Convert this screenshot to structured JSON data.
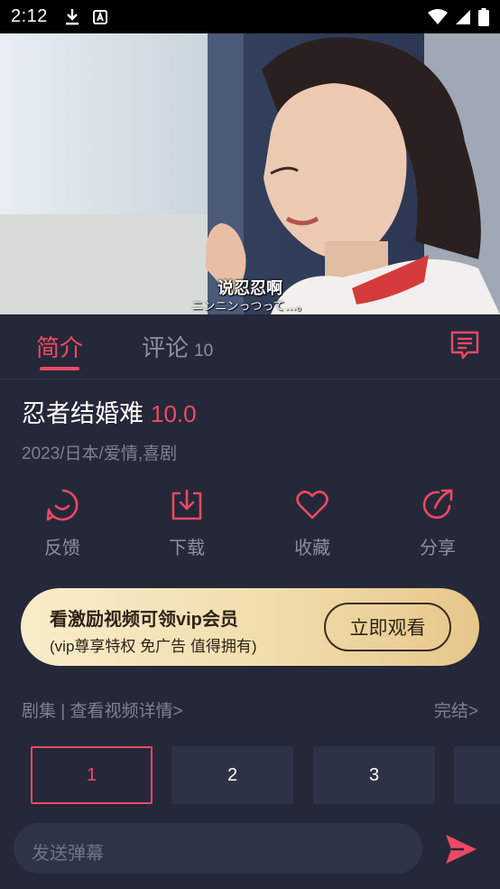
{
  "status_bar": {
    "time": "2:12",
    "icons": [
      "download-icon",
      "a-icon",
      "wifi-icon",
      "signal-icon",
      "battery-icon"
    ]
  },
  "video": {
    "subtitle_main": "说忍忍啊",
    "subtitle_sub": "ニンニンっつって…。"
  },
  "tabs": {
    "intro_label": "简介",
    "comment_label": "评论",
    "comment_count": "10"
  },
  "detail": {
    "title": "忍者结婚难",
    "score": "10.0",
    "meta": "2023/日本/爱情,喜剧"
  },
  "actions": [
    {
      "label": "反馈",
      "icon": "smile-icon"
    },
    {
      "label": "下载",
      "icon": "download-icon"
    },
    {
      "label": "收藏",
      "icon": "heart-icon"
    },
    {
      "label": "分享",
      "icon": "share-icon"
    }
  ],
  "vip_banner": {
    "title": "看激励视频可领vip会员",
    "subtitle": "(vip尊享特权 免广告 值得拥有)",
    "button_label": "立即观看"
  },
  "episodes": {
    "header": "剧集 | 查看视频详情>",
    "status": "完结>",
    "items": [
      "1",
      "2",
      "3"
    ],
    "selected": "1"
  },
  "comment_input": {
    "placeholder": "发送弹幕"
  },
  "colors": {
    "accent": "#ec4a63",
    "background": "#252839",
    "gold": "#f1dfb0"
  }
}
